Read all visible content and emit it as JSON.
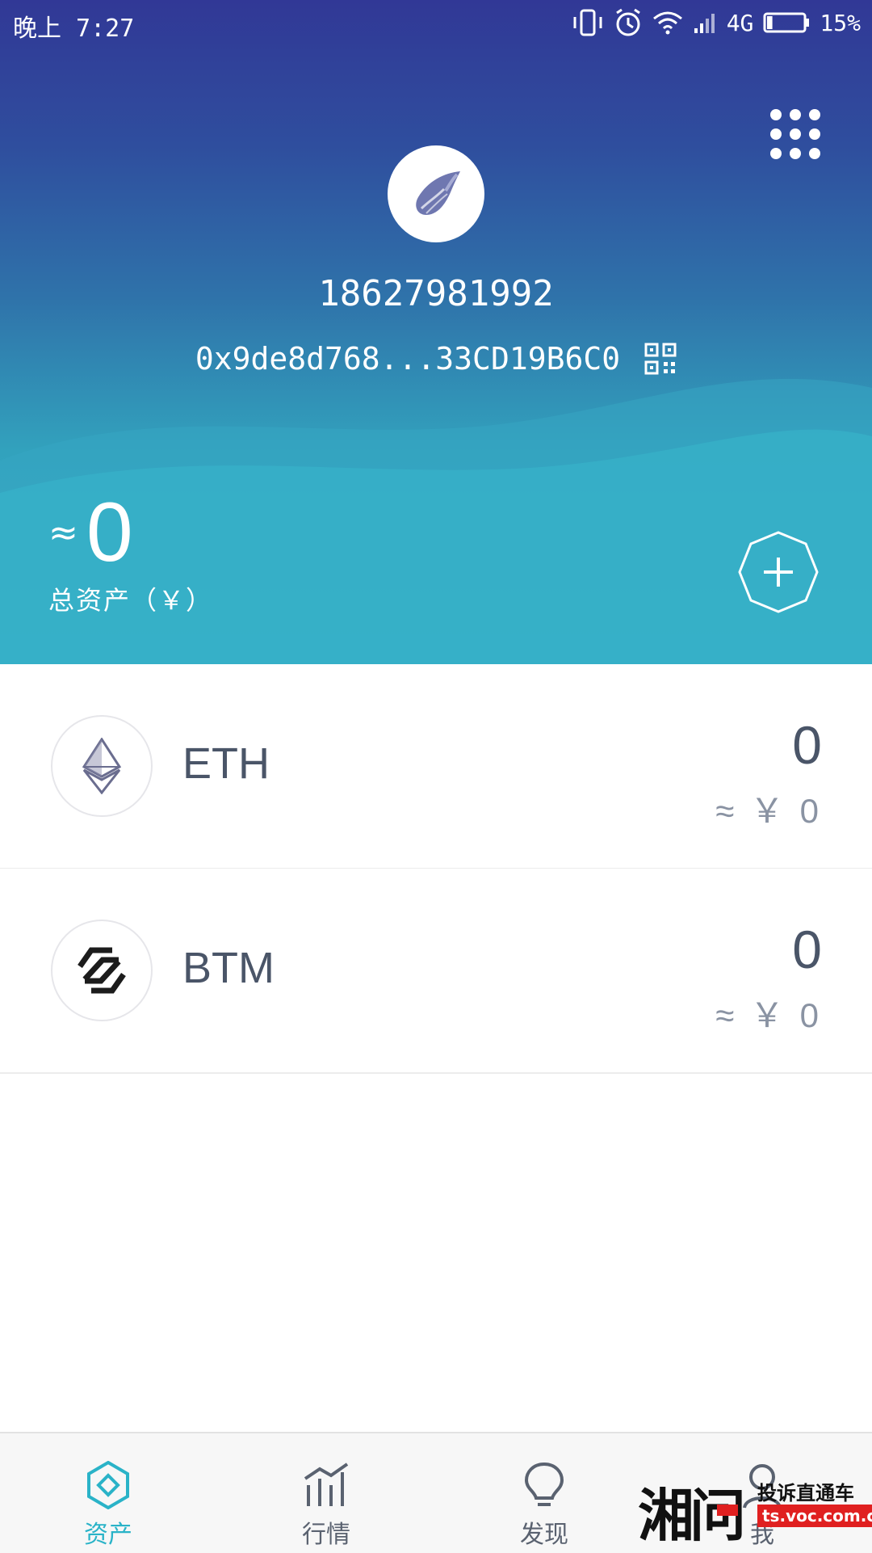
{
  "status_bar": {
    "time": "晚上 7:27",
    "network": "4G",
    "battery_pct": "15%",
    "battery_level": 0.15,
    "icons": [
      "vibrate-icon",
      "alarm-icon",
      "wifi-icon",
      "signal-icon",
      "battery-icon"
    ]
  },
  "wallet": {
    "phone": "18627981992",
    "address": "0x9de8d768...33CD19B6C0",
    "avatar_icon": "conch-shell-icon"
  },
  "total": {
    "approx_symbol": "≈",
    "value": "0",
    "label": "总资产（￥）"
  },
  "assets": [
    {
      "symbol": "ETH",
      "amount": "0",
      "fiat": "≈ ￥ 0",
      "icon": "eth-icon"
    },
    {
      "symbol": "BTM",
      "amount": "0",
      "fiat": "≈ ￥ 0",
      "icon": "btm-icon"
    }
  ],
  "tabs": [
    {
      "label": "资产",
      "icon": "assets-icon",
      "active": true
    },
    {
      "label": "行情",
      "icon": "market-chart-icon",
      "active": false
    },
    {
      "label": "发现",
      "icon": "lightbulb-icon",
      "active": false
    },
    {
      "label": "我",
      "icon": "profile-icon",
      "active": false
    }
  ],
  "watermark": {
    "brand": "湘问",
    "line1": "投诉直通车",
    "line2": "ts.voc.com.cn"
  },
  "colors": {
    "accent": "#2ab3c8",
    "header_top": "#313896",
    "header_bottom": "#37b5c8"
  }
}
